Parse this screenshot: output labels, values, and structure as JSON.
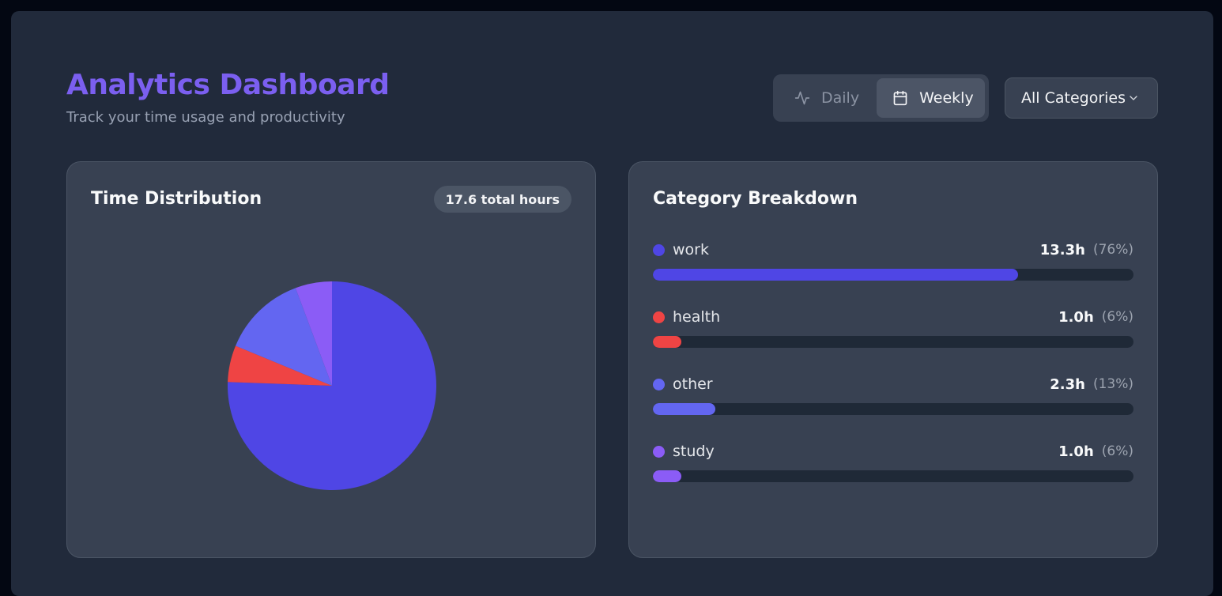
{
  "header": {
    "title": "Analytics Dashboard",
    "subtitle": "Track your time usage and productivity"
  },
  "view_toggle": {
    "options": [
      {
        "label": "Daily",
        "icon": "activity-icon",
        "selected": false
      },
      {
        "label": "Weekly",
        "icon": "calendar-icon",
        "selected": true
      }
    ]
  },
  "category_filter": {
    "value": "All Categories",
    "icon": "chevron-down-icon"
  },
  "time_distribution": {
    "title": "Time Distribution",
    "badge": "17.6 total hours"
  },
  "category_breakdown": {
    "title": "Category Breakdown",
    "items": [
      {
        "name": "work",
        "hours": "13.3h",
        "percent": "(76%)",
        "fraction": 0.76,
        "color": "#4f46e5"
      },
      {
        "name": "health",
        "hours": "1.0h",
        "percent": "(6%)",
        "fraction": 0.06,
        "color": "#ef4444"
      },
      {
        "name": "other",
        "hours": "2.3h",
        "percent": "(13%)",
        "fraction": 0.13,
        "color": "#6366f1"
      },
      {
        "name": "study",
        "hours": "1.0h",
        "percent": "(6%)",
        "fraction": 0.06,
        "color": "#8b5cf6"
      }
    ]
  },
  "chart_data": {
    "type": "pie",
    "categories": [
      "work",
      "health",
      "other",
      "study"
    ],
    "values": [
      13.3,
      1.0,
      2.3,
      1.0
    ],
    "colors": [
      "#4f46e5",
      "#ef4444",
      "#6366f1",
      "#8b5cf6"
    ]
  },
  "colors": {
    "accent": "#7b5ff0",
    "background": "#212a3b",
    "card": "#384152"
  }
}
